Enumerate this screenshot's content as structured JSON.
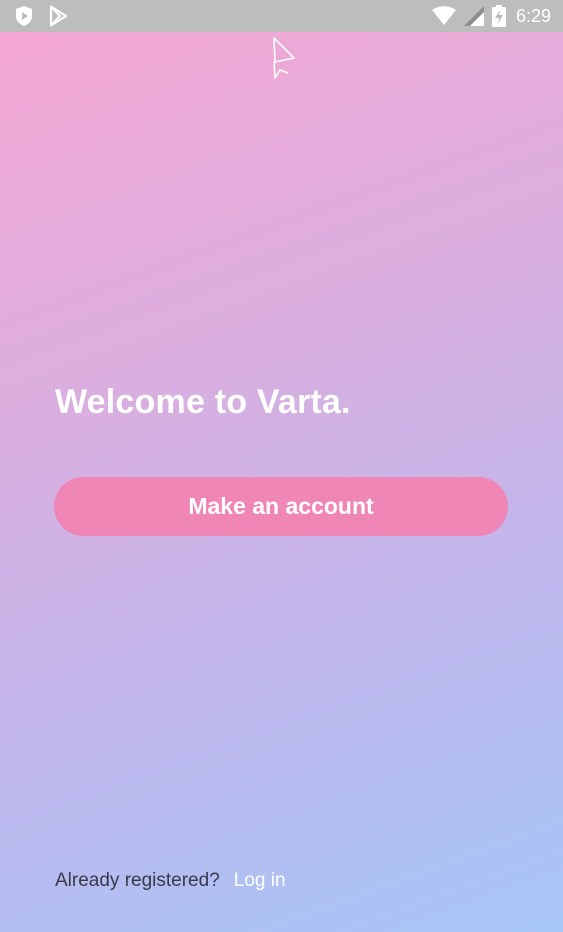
{
  "status_bar": {
    "time": "6:29",
    "left_icons": [
      "shield-notification-icon",
      "play-store-icon"
    ],
    "right_icons": [
      "wifi-icon",
      "cell-signal-icon",
      "battery-charging-icon"
    ],
    "background": "#bdbdbd"
  },
  "app": {
    "logo_icon": "varta-logo-icon",
    "welcome_text": "Welcome to Varta.",
    "primary_button_label": "Make an account",
    "login_prompt": "Already registered?",
    "login_link": "Log in"
  },
  "colors": {
    "gradient_start": "#f7a6d2",
    "gradient_end": "#a6c6f6",
    "button": "#ef86b6",
    "text_light": "#ffffff",
    "text_dark": "#3a3a4a"
  }
}
